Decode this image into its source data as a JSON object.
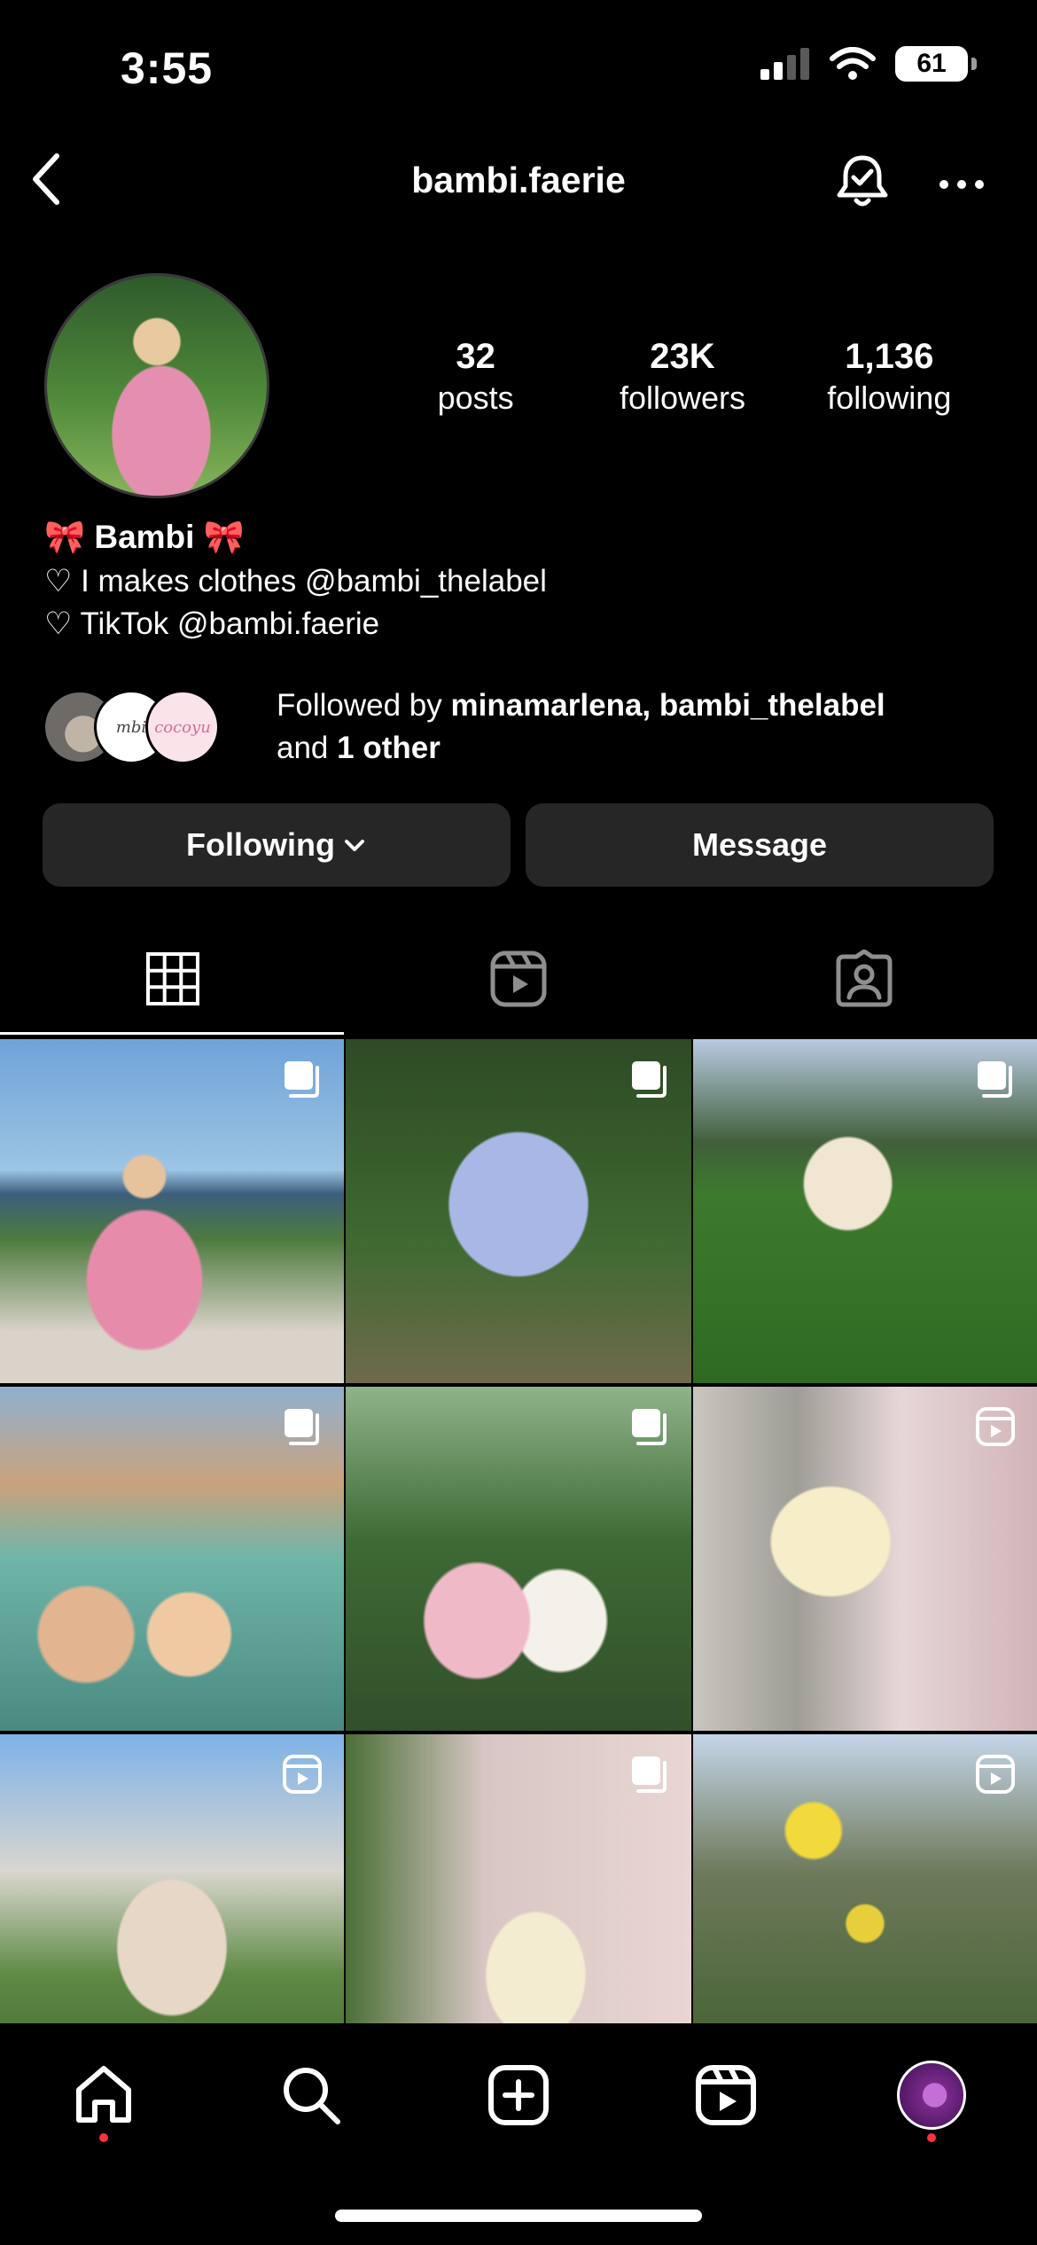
{
  "status_bar": {
    "time": "3:55",
    "battery": "61"
  },
  "header": {
    "username": "bambi.faerie"
  },
  "stats": [
    {
      "value": "32",
      "label": "posts"
    },
    {
      "value": "23K",
      "label": "followers"
    },
    {
      "value": "1,136",
      "label": "following"
    }
  ],
  "bio": {
    "name": "🎀 Bambi 🎀",
    "lines": [
      "♡ I makes clothes @bambi_thelabel",
      "♡ TikTok @bambi.faerie"
    ]
  },
  "mutual": {
    "prefix": "Followed by ",
    "names": "minamarlena, bambi_thelabel",
    "middle": "and ",
    "other": "1 other",
    "avatar_texts": [
      "mbi",
      "cocoyu"
    ]
  },
  "actions": {
    "following": "Following",
    "message": "Message"
  },
  "tabs": [
    "grid-tab",
    "reels-tab",
    "tagged-tab"
  ],
  "grid": [
    {
      "badge": "carousel-icon"
    },
    {
      "badge": "carousel-icon"
    },
    {
      "badge": "carousel-icon"
    },
    {
      "badge": "carousel-icon"
    },
    {
      "badge": "carousel-icon"
    },
    {
      "badge": "reel-icon"
    },
    {
      "badge": "reel-icon"
    },
    {
      "badge": "carousel-icon"
    },
    {
      "badge": "reel-icon"
    }
  ],
  "bottom_nav": [
    "home",
    "search",
    "create",
    "reels",
    "profile"
  ],
  "colors": {
    "background": "#000000",
    "button": "#262626",
    "notification_dot": "#ff3040"
  }
}
